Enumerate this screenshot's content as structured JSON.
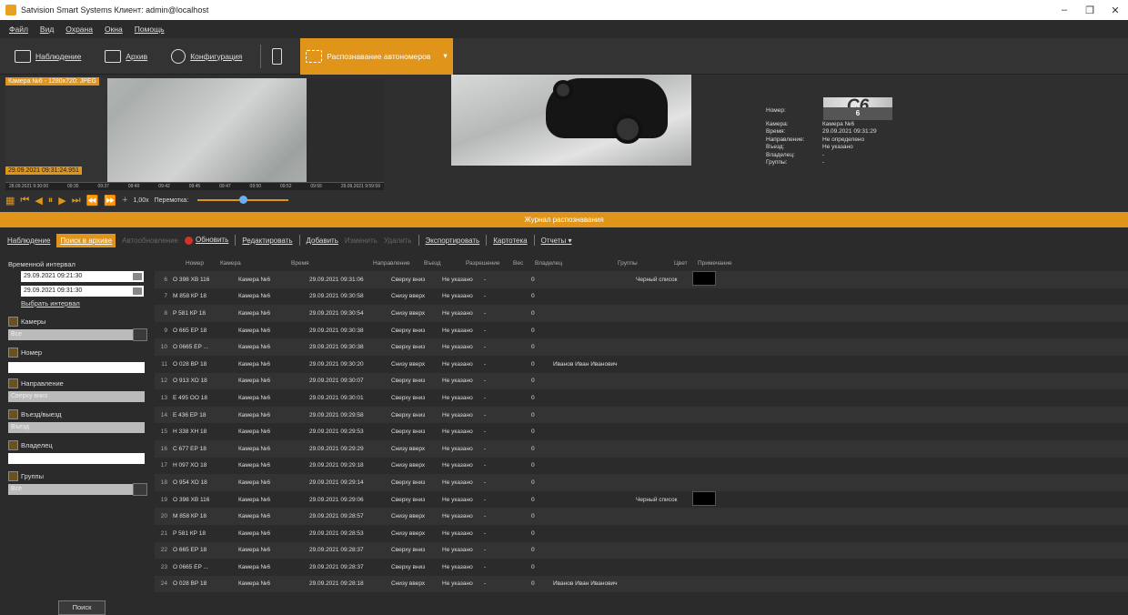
{
  "window": {
    "title": "Satvision Smart Systems Клиент: admin@localhost"
  },
  "menu": [
    "Файл",
    "Вид",
    "Охрана",
    "Окна",
    "Помощь"
  ],
  "toolbar": {
    "monitoring": "Наблюдение",
    "archive": "Архив",
    "config": "Конфигурация",
    "plate_recognition": "Распознавание автономеров"
  },
  "viewer": {
    "cam_label": "Камера №6 - 1280x720: JPEG",
    "cam_time": "29.09.2021 09:31:24.951",
    "timeline_ticks": [
      "28.09.2021 9:30:00",
      "09:35",
      "09:37",
      "09:40",
      "09:42",
      "09:45",
      "09:47",
      "09:50",
      "09:52",
      "09:55",
      "29.09.2021 9:59:59"
    ],
    "speed": "1,00x",
    "rewind_label": "Перемотка:"
  },
  "plate_info": {
    "plate_image_text": "C6",
    "fields": [
      {
        "k": "Номер:",
        "v": "6"
      },
      {
        "k": "Камера:",
        "v": "Камера №6"
      },
      {
        "k": "Время:",
        "v": "29.09.2021 09:31:29"
      },
      {
        "k": "Направление:",
        "v": "Не определено"
      },
      {
        "k": "Въезд:",
        "v": "Не указано"
      },
      {
        "k": "Владелец:",
        "v": "-"
      },
      {
        "k": "Группы:",
        "v": "-"
      }
    ]
  },
  "journal_title": "Журнал распознавания",
  "actions": {
    "monitoring": "Наблюдение",
    "archive_search": "Поиск в архиве",
    "auto_refresh": "Автообновление",
    "refresh": "Обновить",
    "edit": "Редактировать",
    "add": "Добавить",
    "change": "Изменить",
    "delete": "Удалить",
    "export": "Экспортировать",
    "cards": "Картотека",
    "reports": "Отчеты"
  },
  "filters": {
    "time_interval": "Временной интервал",
    "from": "29.09.2021 09:21:30",
    "to": "29.09.2021 09:31:30",
    "pick_interval": "Выбрать интервал",
    "cameras": "Камеры",
    "cameras_value": "Все",
    "number": "Номер",
    "direction": "Направление",
    "direction_value": "Сверху вниз",
    "entry": "Въезд/выезд",
    "entry_value": "Въезд",
    "owner": "Владелец",
    "groups": "Группы",
    "groups_value": "Все",
    "search": "Поиск"
  },
  "table": {
    "headers": [
      "Номер",
      "Камера",
      "Время",
      "Направление",
      "Въезд",
      "Разрешение",
      "Вес",
      "Владелец",
      "Группы",
      "Цвет",
      "Примечание"
    ],
    "rows": [
      [
        "6",
        "О 398 ХВ 116",
        "Камера №6",
        "29.09.2021 09:31:06",
        "Сверху вниз",
        "Не указано",
        "-",
        "0",
        "",
        "Черный список",
        "black"
      ],
      [
        "7",
        "М 858 КР 18",
        "Камера №6",
        "29.09.2021 09:30:58",
        "Снизу вверх",
        "Не указано",
        "-",
        "0",
        "",
        "",
        ""
      ],
      [
        "8",
        "Р 581 КР 18",
        "Камера №6",
        "29.09.2021 09:30:54",
        "Снизу вверх",
        "Не указано",
        "-",
        "0",
        "",
        "",
        ""
      ],
      [
        "9",
        "О 665 ЕР 18",
        "Камера №6",
        "29.09.2021 09:30:38",
        "Сверху вниз",
        "Не указано",
        "-",
        "0",
        "",
        "",
        ""
      ],
      [
        "10",
        "О 0665 ЕР ...",
        "Камера №6",
        "29.09.2021 09:30:38",
        "Сверху вниз",
        "Не указано",
        "-",
        "0",
        "",
        "",
        ""
      ],
      [
        "11",
        "О 028 ВР 18",
        "Камера №6",
        "29.09.2021 09:30:20",
        "Снизу вверх",
        "Не указано",
        "-",
        "0",
        "Иванов Иван Иванович",
        "",
        ""
      ],
      [
        "12",
        "О 913 ХО 18",
        "Камера №6",
        "29.09.2021 09:30:07",
        "Сверху вниз",
        "Не указано",
        "-",
        "0",
        "",
        "",
        ""
      ],
      [
        "13",
        "Е 495 ОО 18",
        "Камера №6",
        "29.09.2021 09:30:01",
        "Сверху вниз",
        "Не указано",
        "-",
        "0",
        "",
        "",
        ""
      ],
      [
        "14",
        "Е 436 ЕР 18",
        "Камера №6",
        "29.09.2021 09:29:58",
        "Сверху вниз",
        "Не указано",
        "-",
        "0",
        "",
        "",
        ""
      ],
      [
        "15",
        "Н 338 ХН 18",
        "Камера №6",
        "29.09.2021 09:29:53",
        "Сверху вниз",
        "Не указано",
        "-",
        "0",
        "",
        "",
        ""
      ],
      [
        "16",
        "С 677 ЕР 18",
        "Камера №6",
        "29.09.2021 09:29:29",
        "Снизу вверх",
        "Не указано",
        "-",
        "0",
        "",
        "",
        ""
      ],
      [
        "17",
        "Н 097 ХО 18",
        "Камера №6",
        "29.09.2021 09:29:18",
        "Снизу вверх",
        "Не указано",
        "-",
        "0",
        "",
        "",
        ""
      ],
      [
        "18",
        "О 954 ХО 18",
        "Камера №6",
        "29.09.2021 09:29:14",
        "Сверху вниз",
        "Не указано",
        "-",
        "0",
        "",
        "",
        ""
      ],
      [
        "19",
        "О 398 ХВ 116",
        "Камера №6",
        "29.09.2021 09:29:06",
        "Сверху вниз",
        "Не указано",
        "-",
        "0",
        "",
        "Черный список",
        "black"
      ],
      [
        "20",
        "М 858 КР 18",
        "Камера №6",
        "29.09.2021 09:28:57",
        "Снизу вверх",
        "Не указано",
        "-",
        "0",
        "",
        "",
        ""
      ],
      [
        "21",
        "Р 581 КР 18",
        "Камера №6",
        "29.09.2021 09:28:53",
        "Снизу вверх",
        "Не указано",
        "-",
        "0",
        "",
        "",
        ""
      ],
      [
        "22",
        "О 665 ЕР 18",
        "Камера №6",
        "29.09.2021 09:28:37",
        "Сверху вниз",
        "Не указано",
        "-",
        "0",
        "",
        "",
        ""
      ],
      [
        "23",
        "О 0665 ЕР ...",
        "Камера №6",
        "29.09.2021 09:28:37",
        "Сверху вниз",
        "Не указано",
        "-",
        "0",
        "",
        "",
        ""
      ],
      [
        "24",
        "О 028 ВР 18",
        "Камера №6",
        "29.09.2021 09:28:18",
        "Снизу вверх",
        "Не указано",
        "-",
        "0",
        "Иванов Иван Иванович",
        "",
        ""
      ]
    ]
  }
}
